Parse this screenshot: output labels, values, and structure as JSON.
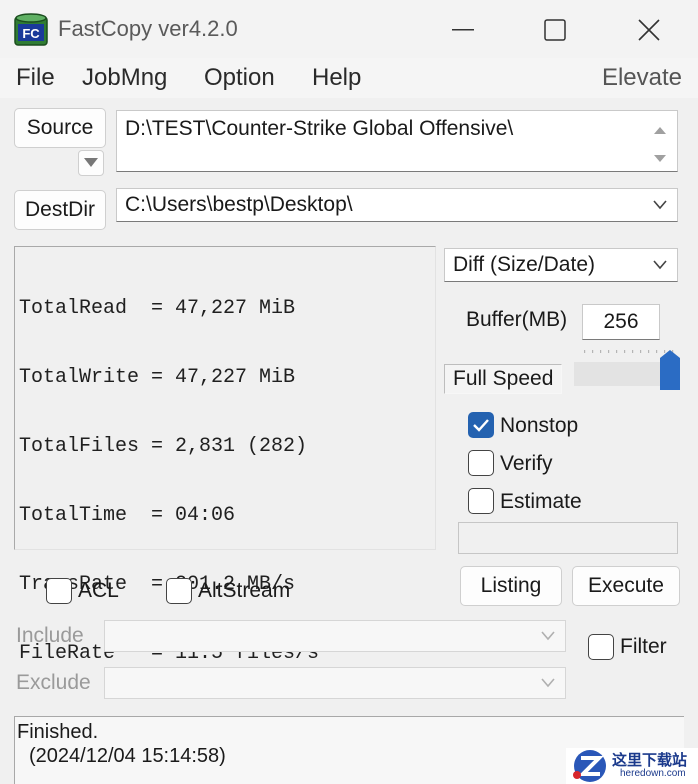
{
  "window": {
    "title": "FastCopy ver4.2.0",
    "icon_text": "FC"
  },
  "menu": {
    "file": "File",
    "jobmng": "JobMng",
    "option": "Option",
    "help": "Help",
    "elevate": "Elevate"
  },
  "source": {
    "button_label": "Source",
    "path": "D:\\TEST\\Counter-Strike Global Offensive\\"
  },
  "dest": {
    "button_label": "DestDir",
    "path": "C:\\Users\\bestp\\Desktop\\"
  },
  "stats": {
    "lines": [
      "TotalRead  = 47,227 MiB",
      "TotalWrite = 47,227 MiB",
      "TotalFiles = 2,831 (282)",
      "TotalTime  = 04:06",
      "TransRate  = 201.2 MB/s",
      "FileRate   = 11.5 files/s"
    ]
  },
  "options": {
    "mode_selected": "Diff (Size/Date)",
    "buffer_label": "Buffer(MB)",
    "buffer_value": "256",
    "speed_label": "Full Speed",
    "speed_level": 1.0,
    "nonstop_label": "Nonstop",
    "nonstop_checked": true,
    "verify_label": "Verify",
    "verify_checked": false,
    "estimate_label": "Estimate",
    "estimate_checked": false
  },
  "actions": {
    "listing": "Listing",
    "execute": "Execute"
  },
  "flags": {
    "acl_label": "ACL",
    "altstream_label": "AltStream",
    "filter_label": "Filter"
  },
  "filters": {
    "include_label": "Include",
    "exclude_label": "Exclude"
  },
  "status": {
    "line1": "Finished.",
    "line2": "(2024/12/04 15:14:58)"
  },
  "watermark": {
    "cn_text": "这里下载站",
    "url_text": "heredown.com"
  },
  "colors": {
    "accent": "#2462b0",
    "slider_thumb": "#2b6cc4",
    "icon_green": "#3a8a3e"
  }
}
